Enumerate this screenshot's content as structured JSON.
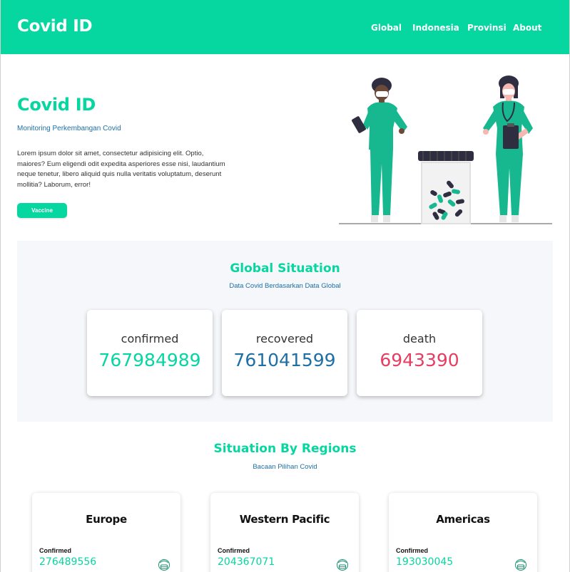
{
  "nav": {
    "brand": "Covid ID",
    "links": [
      "Global",
      "Indonesia",
      "Provinsi",
      "About"
    ]
  },
  "hero": {
    "title": "Covid ID",
    "subtitle": "Monitoring Perkembangan Covid",
    "body": "Lorem ipsum dolor sit amet, consectetur adipisicing elit. Optio, maiores? Eum eligendi odit expedita asperiores esse nisi, laudantium neque tenetur, libero aliquid quis nulla veritatis voluptatum, deserunt mollitia? Laborum, error!",
    "button_label": "Vaccine"
  },
  "global": {
    "title": "Global Situation",
    "subtitle": "Data Covid Berdasarkan Data Global",
    "stats": [
      {
        "label": "confirmed",
        "value": "767984989",
        "color": "#06d6a0"
      },
      {
        "label": "recovered",
        "value": "761041599",
        "color": "#1d6fa5"
      },
      {
        "label": "death",
        "value": "6943390",
        "color": "#e63e62"
      }
    ]
  },
  "regions": {
    "title": "Situation By Regions",
    "subtitle": "Bacaan Pilihan Covid",
    "cards": [
      {
        "name": "Europe",
        "confirmed_label": "Confirmed",
        "confirmed": "276489556",
        "icon": "masked-face-icon"
      },
      {
        "name": "Western Pacific",
        "confirmed_label": "Confirmed",
        "confirmed": "204367071",
        "icon": "masked-face-icon"
      },
      {
        "name": "Americas",
        "confirmed_label": "Confirmed",
        "confirmed": "193030045",
        "icon": "masked-face-icon"
      }
    ]
  },
  "colors": {
    "accent": "#06d6a0",
    "blue": "#1d6fa5",
    "red": "#e63e62",
    "section_bg": "#f5f7fa"
  }
}
